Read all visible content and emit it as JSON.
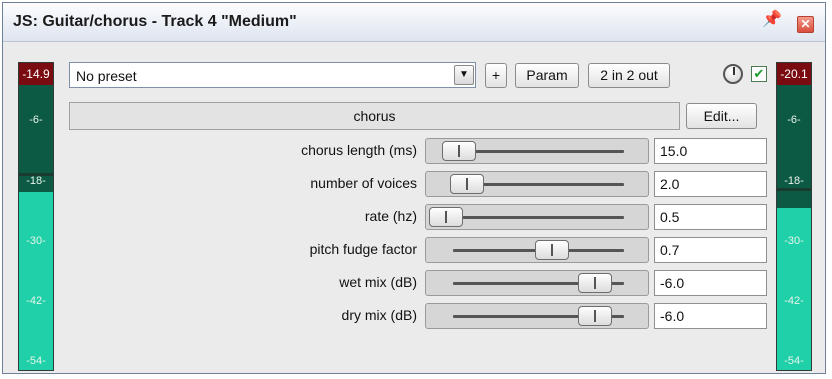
{
  "window": {
    "title": "JS: Guitar/chorus - Track 4 \"Medium\"",
    "pin_icon": "pin-icon",
    "close_icon": "close-icon"
  },
  "meters": {
    "left": {
      "peak": "-14.9",
      "ticks": [
        "-6-",
        "-18-",
        "-30-",
        "-42-",
        "-54-"
      ]
    },
    "right": {
      "peak": "-20.1",
      "ticks": [
        "-6-",
        "-18-",
        "-30-",
        "-42-",
        "-54-"
      ]
    }
  },
  "toolbar": {
    "preset_value": "No preset",
    "add_label": "+",
    "param_label": "Param",
    "routing_label": "2 in 2 out",
    "bypass_checked": true
  },
  "plugin": {
    "name": "chorus",
    "edit_label": "Edit..."
  },
  "params": [
    {
      "label": "chorus length (ms)",
      "value": "15.0",
      "slider_fraction": 0.08
    },
    {
      "label": "number of voices",
      "value": "2.0",
      "slider_fraction": 0.13
    },
    {
      "label": "rate (hz)",
      "value": "0.5",
      "slider_fraction": 0.0
    },
    {
      "label": "pitch fudge factor",
      "value": "0.7",
      "slider_fraction": 0.64
    },
    {
      "label": "wet mix (dB)",
      "value": "-6.0",
      "slider_fraction": 0.9
    },
    {
      "label": "dry mix (dB)",
      "value": "-6.0",
      "slider_fraction": 0.9
    }
  ],
  "colors": {
    "meter_fill": "#1fd0a8",
    "meter_dark": "#0c5a44",
    "peak_red": "#7a0b10",
    "check_green": "#1a9a2a"
  }
}
